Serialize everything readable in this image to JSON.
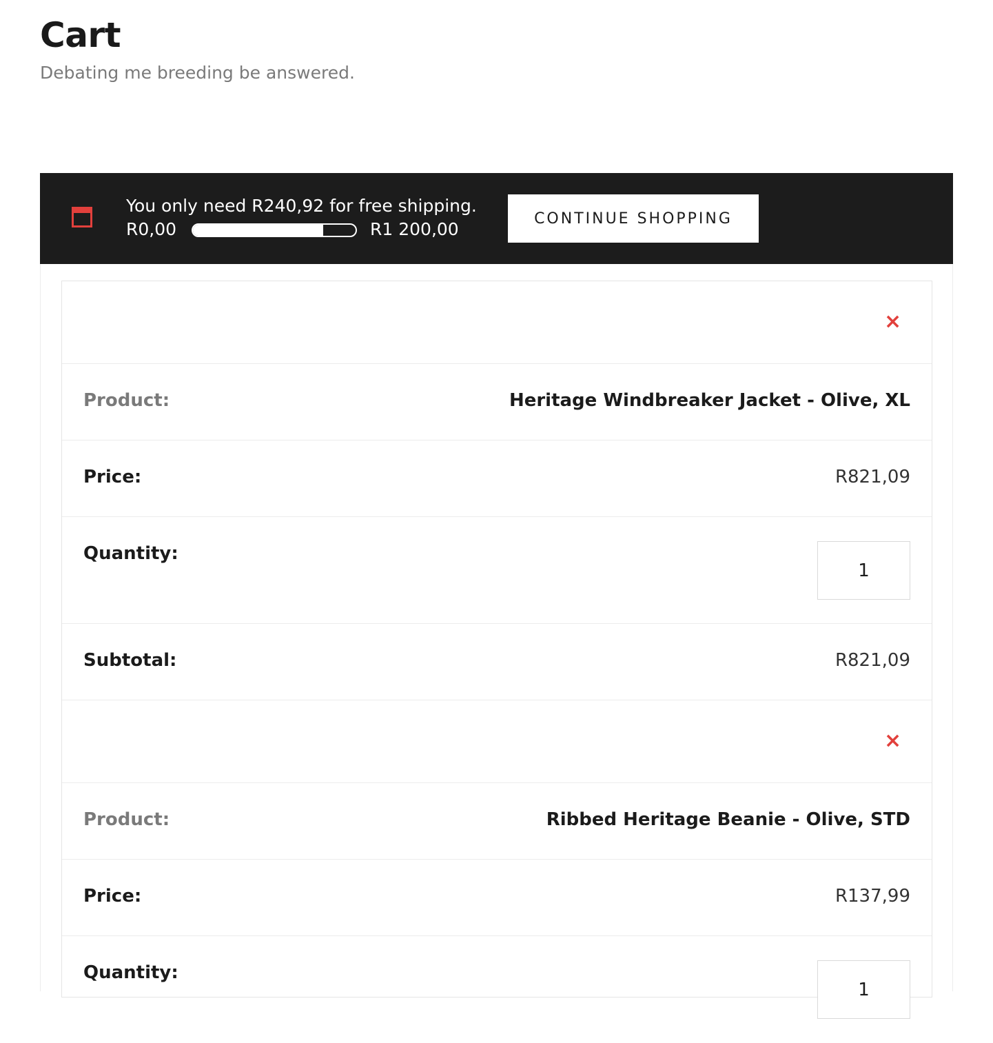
{
  "page": {
    "title": "Cart",
    "subtitle": "Debating me breeding be answered."
  },
  "shipping": {
    "message": "You only need R240,92 for free shipping.",
    "min_label": "R0,00",
    "max_label": "R1 200,00",
    "progress": 0.8,
    "button_label": "CONTINUE SHOPPING",
    "icon": "calendar-icon"
  },
  "labels": {
    "product": "Product:",
    "price": "Price:",
    "quantity": "Quantity:",
    "subtotal": "Subtotal:",
    "remove": "×"
  },
  "items": [
    {
      "product": "Heritage Windbreaker Jacket - Olive, XL",
      "price": "R821,09",
      "quantity": "1",
      "subtotal": "R821,09"
    },
    {
      "product": "Ribbed Heritage Beanie - Olive, STD",
      "price": "R137,99",
      "quantity": "1"
    }
  ],
  "colors": {
    "accent": "#e2403c",
    "bar_background": "#1c1c1c"
  }
}
